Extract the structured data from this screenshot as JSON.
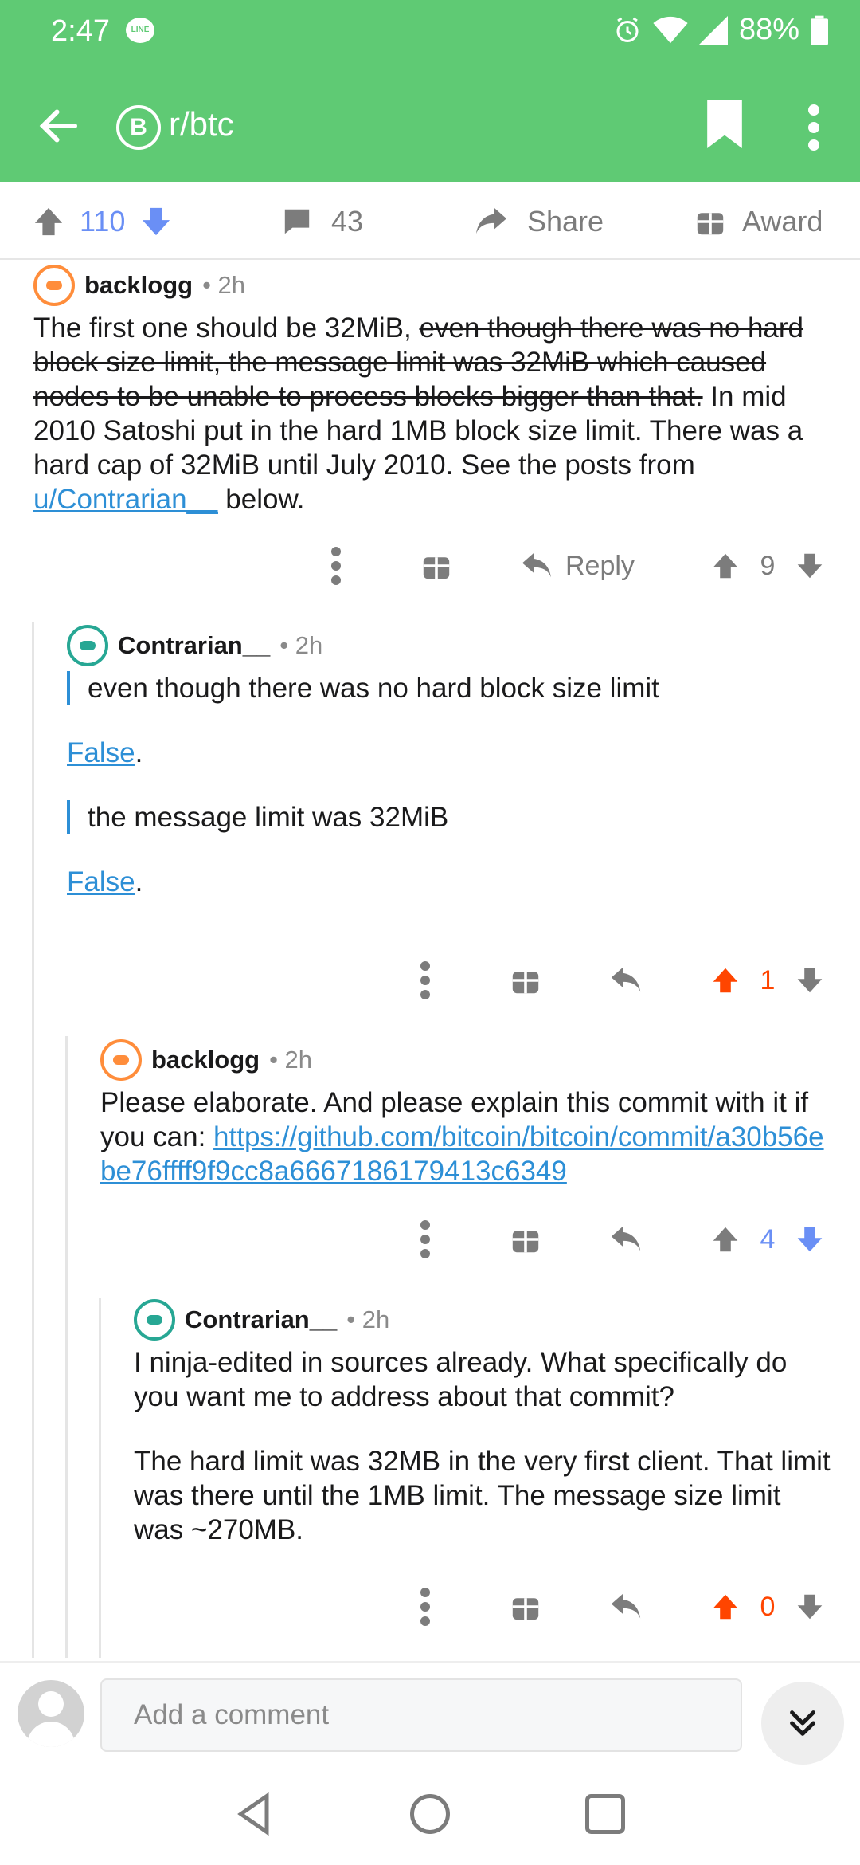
{
  "status_bar": {
    "time": "2:47",
    "notification_badge": "LINE",
    "battery": "88%"
  },
  "app_bar": {
    "subreddit": "r/btc",
    "subreddit_icon_letter": "B"
  },
  "post_bar": {
    "upvotes": "110",
    "comments": "43",
    "share_label": "Share",
    "award_label": "Award"
  },
  "comments": [
    {
      "user": "backlogg",
      "meta": "• 2h",
      "body_normal_1": "The first one should be 32MiB, ",
      "body_struck": "even though there was no hard block size limit, the message limit was 32MiB which caused nodes to be unable to process blocks bigger than that.",
      "body_normal_2": " In mid 2010 Satoshi put in the hard 1MB block size limit. There was a hard cap of 32MiB until July 2010. See the posts from ",
      "body_link": "u/Contrarian__",
      "body_normal_3": " below.",
      "reply_label": "Reply",
      "score": "9"
    },
    {
      "user": "Contrarian__",
      "meta": "• 2h",
      "quote_1": "even though there was no hard block size limit",
      "link_1": "False",
      "after_link_1": ".",
      "quote_2": "the message limit was 32MiB",
      "link_2": "False",
      "after_link_2": ".",
      "score": "1"
    },
    {
      "user": "backlogg",
      "meta": "• 2h",
      "body": "Please elaborate. And please explain this commit with it if you can: ",
      "link": "https://github.com/bitcoin/bitcoin/commit/a30b56ebe76ffff9f9cc8a6667186179413c6349",
      "score": "4"
    },
    {
      "user": "Contrarian__",
      "meta": "• 2h",
      "para_1": "I ninja-edited in sources already. What specifically do you want me to address about that commit?",
      "para_2": "The hard limit was 32MB in the very first client. That limit was there until the 1MB limit. The message size limit was ~270MB.",
      "score": "0"
    }
  ],
  "comment_bar": {
    "placeholder": "Add a comment"
  },
  "colors": {
    "brand_green": "#5fca74",
    "upvote_orange": "#ff4500",
    "downvote_blue": "#6a8ff5",
    "link_blue": "#2d8fd6",
    "icon_grey": "#7c7c7c"
  },
  "icons": [
    "back-arrow-icon",
    "bitcoin-icon",
    "bookmark-icon",
    "more-vertical-icon",
    "upvote-icon",
    "downvote-icon",
    "comment-icon",
    "share-icon",
    "gift-icon",
    "reply-icon",
    "chevrons-down-icon"
  ]
}
